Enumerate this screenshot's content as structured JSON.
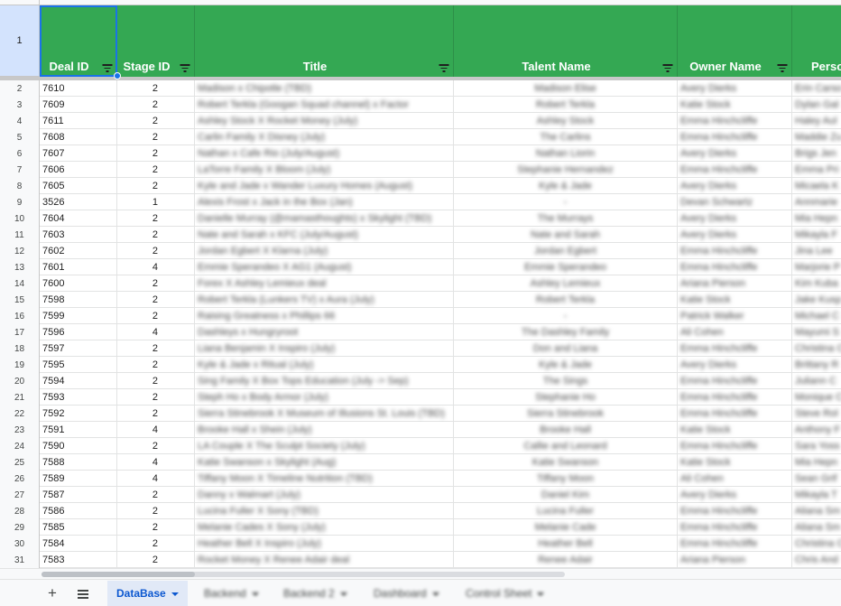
{
  "columns": [
    {
      "key": "deal",
      "label": "Deal ID"
    },
    {
      "key": "stage",
      "label": "Stage ID"
    },
    {
      "key": "title",
      "label": "Title"
    },
    {
      "key": "talent",
      "label": "Talent Name"
    },
    {
      "key": "owner",
      "label": "Owner Name"
    },
    {
      "key": "person",
      "label": "Perso"
    }
  ],
  "header_row_number": "1",
  "rows": [
    {
      "n": "2",
      "deal": "7610",
      "stage": "2",
      "title": "Madison x Chipotle (TBD)",
      "talent": "Madison Elise",
      "owner": "Avery Dierks",
      "person": "Erin Carso"
    },
    {
      "n": "3",
      "deal": "7609",
      "stage": "2",
      "title": "Robert Terkla (Googan Squad channel) x Factor",
      "talent": "Robert Terkla",
      "owner": "Katie Stock",
      "person": "Dylan Gal"
    },
    {
      "n": "4",
      "deal": "7611",
      "stage": "2",
      "title": "Ashley Stock X Rocket Money (July)",
      "talent": "Ashley Stock",
      "owner": "Emma Hinchcliffe",
      "person": "Haley Aul"
    },
    {
      "n": "5",
      "deal": "7608",
      "stage": "2",
      "title": "Carlin Family X Disney (July)",
      "talent": "The Carlins",
      "owner": "Emma Hinchcliffe",
      "person": "Maddie Zu"
    },
    {
      "n": "6",
      "deal": "7607",
      "stage": "2",
      "title": "Nathan x Cafe Rio (July/August)",
      "talent": "Nathan Liorin",
      "owner": "Avery Dierks",
      "person": "Brigs Jen"
    },
    {
      "n": "7",
      "deal": "7606",
      "stage": "2",
      "title": "LaTorre Family X Bloom (July)",
      "talent": "Stephanie Hernandez",
      "owner": "Emma Hinchcliffe",
      "person": "Emma Pri"
    },
    {
      "n": "8",
      "deal": "7605",
      "stage": "2",
      "title": "Kyle and Jade x Wander Luxury Homes (August)",
      "talent": "Kyle & Jade",
      "owner": "Avery Dierks",
      "person": "Micaela K"
    },
    {
      "n": "9",
      "deal": "3526",
      "stage": "1",
      "title": "Alexis Frost x Jack in the Box (Jan)",
      "talent": "-",
      "owner": "Devan Schwartz",
      "person": "Annmarie"
    },
    {
      "n": "10",
      "deal": "7604",
      "stage": "2",
      "title": "Danielle Murray (@mamasthoughts) x Skylight (TBD)",
      "talent": "The Murrays",
      "owner": "Avery Dierks",
      "person": "Mia Hepn"
    },
    {
      "n": "11",
      "deal": "7603",
      "stage": "2",
      "title": "Nate and Sarah x KFC (July/August)",
      "talent": "Nate and Sarah",
      "owner": "Avery Dierks",
      "person": "Mikayla F"
    },
    {
      "n": "12",
      "deal": "7602",
      "stage": "2",
      "title": "Jordan Egbert X Klarna (July)",
      "talent": "Jordan Egbert",
      "owner": "Emma Hinchcliffe",
      "person": "Jina Lee"
    },
    {
      "n": "13",
      "deal": "7601",
      "stage": "4",
      "title": "Emmie Sperandeo X AG1 (August)",
      "talent": "Emmie Sperandeo",
      "owner": "Emma Hinchcliffe",
      "person": "Marjorie P"
    },
    {
      "n": "14",
      "deal": "7600",
      "stage": "2",
      "title": "Forex X Ashley Lemieux deal",
      "talent": "Ashley Lemieux",
      "owner": "Ariana Pierson",
      "person": "Kim Kuba"
    },
    {
      "n": "15",
      "deal": "7598",
      "stage": "2",
      "title": "Robert Terkla (Lunkers TV) x Aura (July)",
      "talent": "Robert Terkla",
      "owner": "Katie Stock",
      "person": "Jake Kusp"
    },
    {
      "n": "16",
      "deal": "7599",
      "stage": "2",
      "title": "Raising Greatness x Phillips 66",
      "talent": "-",
      "owner": "Patrick Walker",
      "person": "Michael C"
    },
    {
      "n": "17",
      "deal": "7596",
      "stage": "4",
      "title": "Dashleys x Hungryroot",
      "talent": "The Dashley Family",
      "owner": "Ali Cohen",
      "person": "Mayumi S"
    },
    {
      "n": "18",
      "deal": "7597",
      "stage": "2",
      "title": "Liana Benjamin X Inspiro (July)",
      "talent": "Don and Liana",
      "owner": "Emma Hinchcliffe",
      "person": "Christina C"
    },
    {
      "n": "19",
      "deal": "7595",
      "stage": "2",
      "title": "Kyle & Jade x Ritual (July)",
      "talent": "Kyle & Jade",
      "owner": "Avery Dierks",
      "person": "Brittany R"
    },
    {
      "n": "20",
      "deal": "7594",
      "stage": "2",
      "title": "Sing Family X Box Tops Education (July -> Sep)",
      "talent": "The Sings",
      "owner": "Emma Hinchcliffe",
      "person": "Juliann C"
    },
    {
      "n": "21",
      "deal": "7593",
      "stage": "2",
      "title": "Steph Ho x Body Armor (July)",
      "talent": "Stephanie Ho",
      "owner": "Emma Hinchcliffe",
      "person": "Monique C"
    },
    {
      "n": "22",
      "deal": "7592",
      "stage": "2",
      "title": "Sierra Stinebrook X Museum of Illusions St. Louis (TBD)",
      "talent": "Sierra Stinebrook",
      "owner": "Emma Hinchcliffe",
      "person": "Steve Rol"
    },
    {
      "n": "23",
      "deal": "7591",
      "stage": "4",
      "title": "Brooke Hall x Shein (July)",
      "talent": "Brooke Hall",
      "owner": "Katie Stock",
      "person": "Anthony F"
    },
    {
      "n": "24",
      "deal": "7590",
      "stage": "2",
      "title": "LA Couple X The Sculpt Society (July)",
      "talent": "Callie and Leonard",
      "owner": "Emma Hinchcliffe",
      "person": "Sara Yoss"
    },
    {
      "n": "25",
      "deal": "7588",
      "stage": "4",
      "title": "Katie Swanson x Skylight (Aug)",
      "talent": "Katie Swanson",
      "owner": "Katie Stock",
      "person": "Mia Hepn"
    },
    {
      "n": "26",
      "deal": "7589",
      "stage": "4",
      "title": "Tiffany Moon X Timeline Nutrition (TBD)",
      "talent": "Tiffany Moon",
      "owner": "Ali Cohen",
      "person": "Sean Grif"
    },
    {
      "n": "27",
      "deal": "7587",
      "stage": "2",
      "title": "Danny x Walmart (July)",
      "talent": "Daniel Kim",
      "owner": "Avery Dierks",
      "person": "Mikayla T"
    },
    {
      "n": "28",
      "deal": "7586",
      "stage": "2",
      "title": "Lucina Fuller X Sony (TBD)",
      "talent": "Lucina Fuller",
      "owner": "Emma Hinchcliffe",
      "person": "Aliana Sm"
    },
    {
      "n": "29",
      "deal": "7585",
      "stage": "2",
      "title": "Melanie Cades X Sony (July)",
      "talent": "Melanie Cade",
      "owner": "Emma Hinchcliffe",
      "person": "Aliana Sm"
    },
    {
      "n": "30",
      "deal": "7584",
      "stage": "2",
      "title": "Heather Bell X Inspiro (July)",
      "talent": "Heather Bell",
      "owner": "Emma Hinchcliffe",
      "person": "Christina C"
    },
    {
      "n": "31",
      "deal": "7583",
      "stage": "2",
      "title": "Rocket Money X Renee Adair deal",
      "talent": "Renee Adair",
      "owner": "Ariana Pierson",
      "person": "Chris And"
    }
  ],
  "tabs": {
    "add_icon": "plus-icon",
    "all_sheets_icon": "menu-icon",
    "items": [
      {
        "label": "DataBase",
        "active": true
      },
      {
        "label": "Backend",
        "active": false
      },
      {
        "label": "Backend 2",
        "active": false
      },
      {
        "label": "Dashboard",
        "active": false
      },
      {
        "label": "Control Sheet",
        "active": false
      }
    ]
  },
  "colors": {
    "header_bg": "#34a853",
    "header_text": "#ffffff",
    "active_tab": "#0b57d0",
    "selection": "#1a73e8"
  }
}
